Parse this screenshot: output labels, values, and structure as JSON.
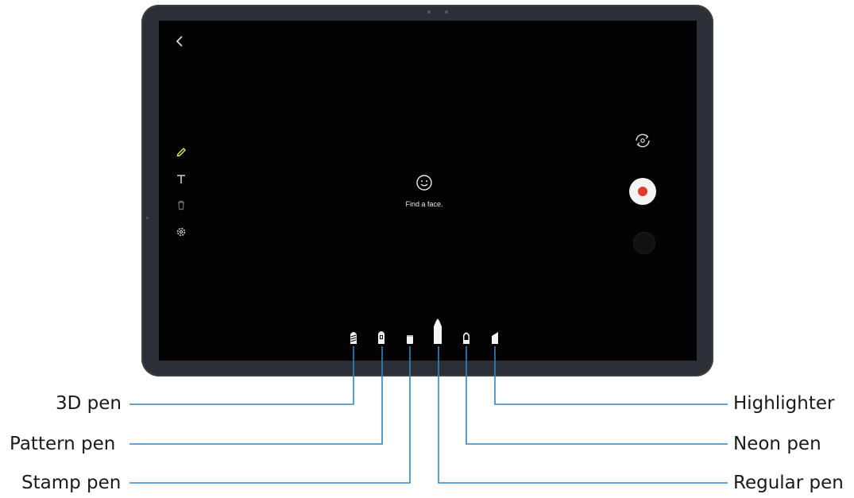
{
  "screen": {
    "back_glyph": "‹",
    "prompt_text": "Find a face.",
    "left_tools": [
      "pencil-icon",
      "text-icon",
      "trash-icon",
      "settings-icon"
    ],
    "right_controls": [
      "switch-camera-icon",
      "record-button",
      "gallery-thumbnail"
    ],
    "record_color": "#e23b2c",
    "pencil_color": "#d4e05a"
  },
  "pens": [
    {
      "id": "3d-pen",
      "label": "3D pen"
    },
    {
      "id": "pattern-pen",
      "label": "Pattern pen"
    },
    {
      "id": "stamp-pen",
      "label": "Stamp pen"
    },
    {
      "id": "regular-pen",
      "label": "Regular pen",
      "selected": true
    },
    {
      "id": "neon-pen",
      "label": "Neon pen"
    },
    {
      "id": "highlighter",
      "label": "Highlighter"
    }
  ],
  "callout_color": "#2f86c4",
  "labels": {
    "pen_3d": "3D pen",
    "pattern": "Pattern pen",
    "stamp": "Stamp pen",
    "highlighter": "Highlighter",
    "neon": "Neon pen",
    "regular": "Regular pen"
  }
}
